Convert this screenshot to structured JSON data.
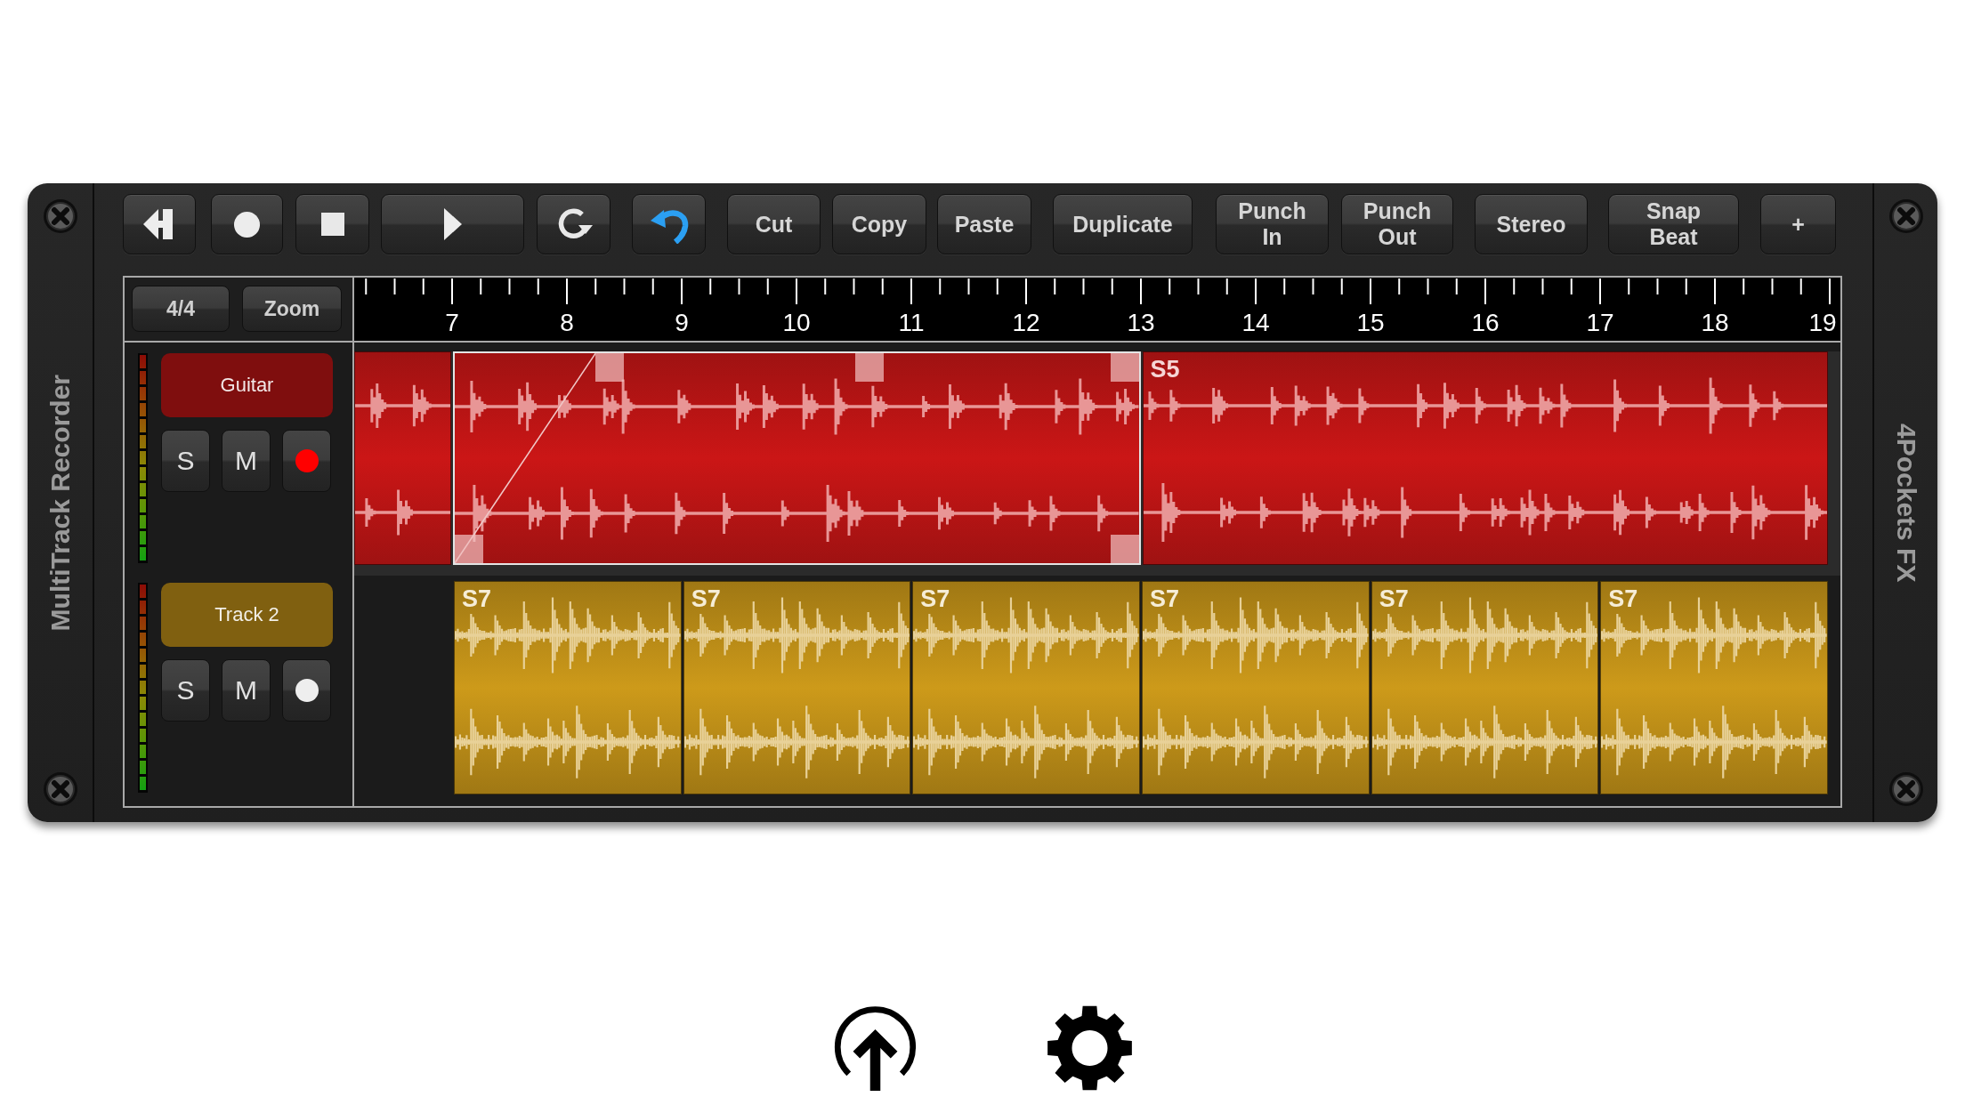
{
  "panel": {
    "left_label": "MultiTrack Recorder",
    "right_label": "4Pockets FX"
  },
  "toolbar": {
    "buttons": [
      {
        "label": "Cut"
      },
      {
        "label": "Copy"
      },
      {
        "label": "Paste"
      },
      {
        "label": "Duplicate"
      },
      {
        "label": "Punch In"
      },
      {
        "label": "Punch Out"
      },
      {
        "label": "Stereo"
      },
      {
        "label": "Snap Beat"
      },
      {
        "label": "+"
      }
    ]
  },
  "timeline_header": {
    "time_signature": "4/4",
    "zoom": "Zoom"
  },
  "ruler": {
    "labels": [
      "7",
      "8",
      "9",
      "10",
      "11",
      "12",
      "13",
      "14",
      "15",
      "16",
      "17",
      "18",
      "19"
    ]
  },
  "tracks": [
    {
      "name": "Guitar",
      "color": "#7f0e0e",
      "selected": true,
      "solo_label": "S",
      "mute_label": "M",
      "armed": true,
      "clips": [
        {
          "kind": "partial",
          "selected": false
        },
        {
          "kind": "clip",
          "selected": true
        },
        {
          "kind": "clip",
          "label": "S5",
          "selected": false
        }
      ]
    },
    {
      "name": "Track 2",
      "color": "#806010",
      "selected": false,
      "solo_label": "S",
      "mute_label": "M",
      "armed": false,
      "clips": [
        {
          "kind": "clip",
          "label": "S7",
          "selected": false
        },
        {
          "kind": "clip",
          "label": "S7",
          "selected": false
        },
        {
          "kind": "clip",
          "label": "S7",
          "selected": false
        },
        {
          "kind": "clip",
          "label": "S7",
          "selected": false
        },
        {
          "kind": "clip",
          "label": "S7",
          "selected": false
        },
        {
          "kind": "clip",
          "label": "S7",
          "selected": false
        }
      ]
    }
  ]
}
